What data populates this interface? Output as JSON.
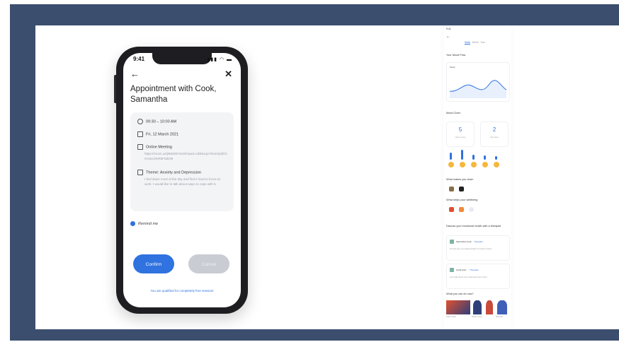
{
  "phone": {
    "status_time": "9:41",
    "status_icons": "▮▮▮ ◠ ▬",
    "back_glyph": "←",
    "close_glyph": "✕",
    "title": "Appointment with Cook, Samantha",
    "time": "09:30 – 10:00 AM",
    "date": "Fri, 12 March 2021",
    "meeting_label": "Online Meeting",
    "meeting_detail": "https://zoom.us/j/6832974109?pwd=Uk9Sa1pYbnZxQ3lCbGV6cUhnR0F0dz09",
    "theme_label": "Theme: Anxiety and Depression",
    "theme_detail": "I feel down most of the day and find it hard to focus at work. I would like to talk about ways to cope with it.",
    "remind_label": "Remind me",
    "confirm_label": "Confirm",
    "cancel_label": "Cancel",
    "qualified_text": "You are qualified for completely free session!"
  },
  "long": {
    "status_time": "9:41",
    "back_glyph": "←",
    "tabs": [
      "Week",
      "Month",
      "Year"
    ],
    "mood_flow": "Your Mood Flow",
    "mood_range": "Week",
    "mood_chart": "Mood Chart",
    "stats": [
      {
        "value": "5",
        "caption": "Happy days"
      },
      {
        "value": "2",
        "caption": "Sad days"
      }
    ],
    "down_title": "What makes you down",
    "wellbeing_title": "What helps your wellbeing",
    "discuss_title": "Discuss your emotional health with a therapist",
    "therapists": [
      {
        "name": "Samantha Cook",
        "tag": "Therapist",
        "text": "Hi! How are you feeling today? I'm here to listen."
      },
      {
        "name": "Carla Ford",
        "tag": "Therapist",
        "text": "Let's talk about your week and how it went."
      }
    ],
    "can_do_title": "What you can do now?",
    "activities": [
      "Take a walk",
      "Read a book",
      "Meditate"
    ]
  },
  "colors": {
    "frame": "#3b4e6e",
    "accent": "#2f72e0",
    "disabled": "#c9ccd2",
    "emoji": "#f6b73c"
  }
}
